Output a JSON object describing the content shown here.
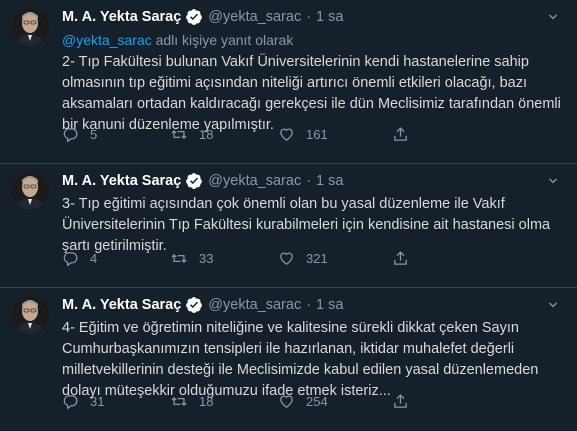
{
  "tweets": [
    {
      "name": "M. A. Yekta Saraç",
      "handle": "@yekta_sarac",
      "dot": "·",
      "time": "1 sa",
      "replying_to": "@yekta_sarac",
      "replying_suffix": " adlı kişiye yanıt olarak",
      "text": "2- Tıp Fakültesi bulunan Vakıf Üniversitelerinin kendi hastanelerine sahip olmasının tıp eğitimi açısından niteliği artırıcı önemli etkileri olacağı, bazı aksamaları ortadan kaldıracağı gerekçesi ile dün Meclisimiz tarafından önemli bir kanuni düzenleme yapılmıştır.",
      "replies": "5",
      "retweets": "18",
      "likes": "161"
    },
    {
      "name": "M. A. Yekta Saraç",
      "handle": "@yekta_sarac",
      "dot": "·",
      "time": "1 sa",
      "text": "3- Tıp eğitimi açısından çok önemli olan bu yasal düzenleme ile Vakıf Üniversitelerinin Tıp Fakültesi kurabilmeleri için kendisine ait hastanesi olma şartı getirilmiştir.",
      "replies": "4",
      "retweets": "33",
      "likes": "321"
    },
    {
      "name": "M. A. Yekta Saraç",
      "handle": "@yekta_sarac",
      "dot": "·",
      "time": "1 sa",
      "text": "4- Eğitim ve öğretimin niteliğine ve kalitesine sürekli dikkat çeken Sayın Cumhurbaşkanımızın tensipleri ile hazırlanan, iktidar muhalefet değerli milletvekillerinin desteği ile Meclisimizde kabul edilen yasal düzenlemeden dolayı müteşekkir olduğumuzu ifade etmek isteriz...",
      "replies": "31",
      "retweets": "18",
      "likes": "254"
    }
  ],
  "icons": {
    "verified": "verified-badge-icon",
    "more": "more-chevron-icon",
    "reply": "reply-icon",
    "retweet": "retweet-icon",
    "like": "heart-icon",
    "share": "share-icon"
  },
  "colors": {
    "background": "#15202b",
    "accent": "#1da1f2",
    "muted": "#8899a6",
    "divider": "#38444d"
  }
}
